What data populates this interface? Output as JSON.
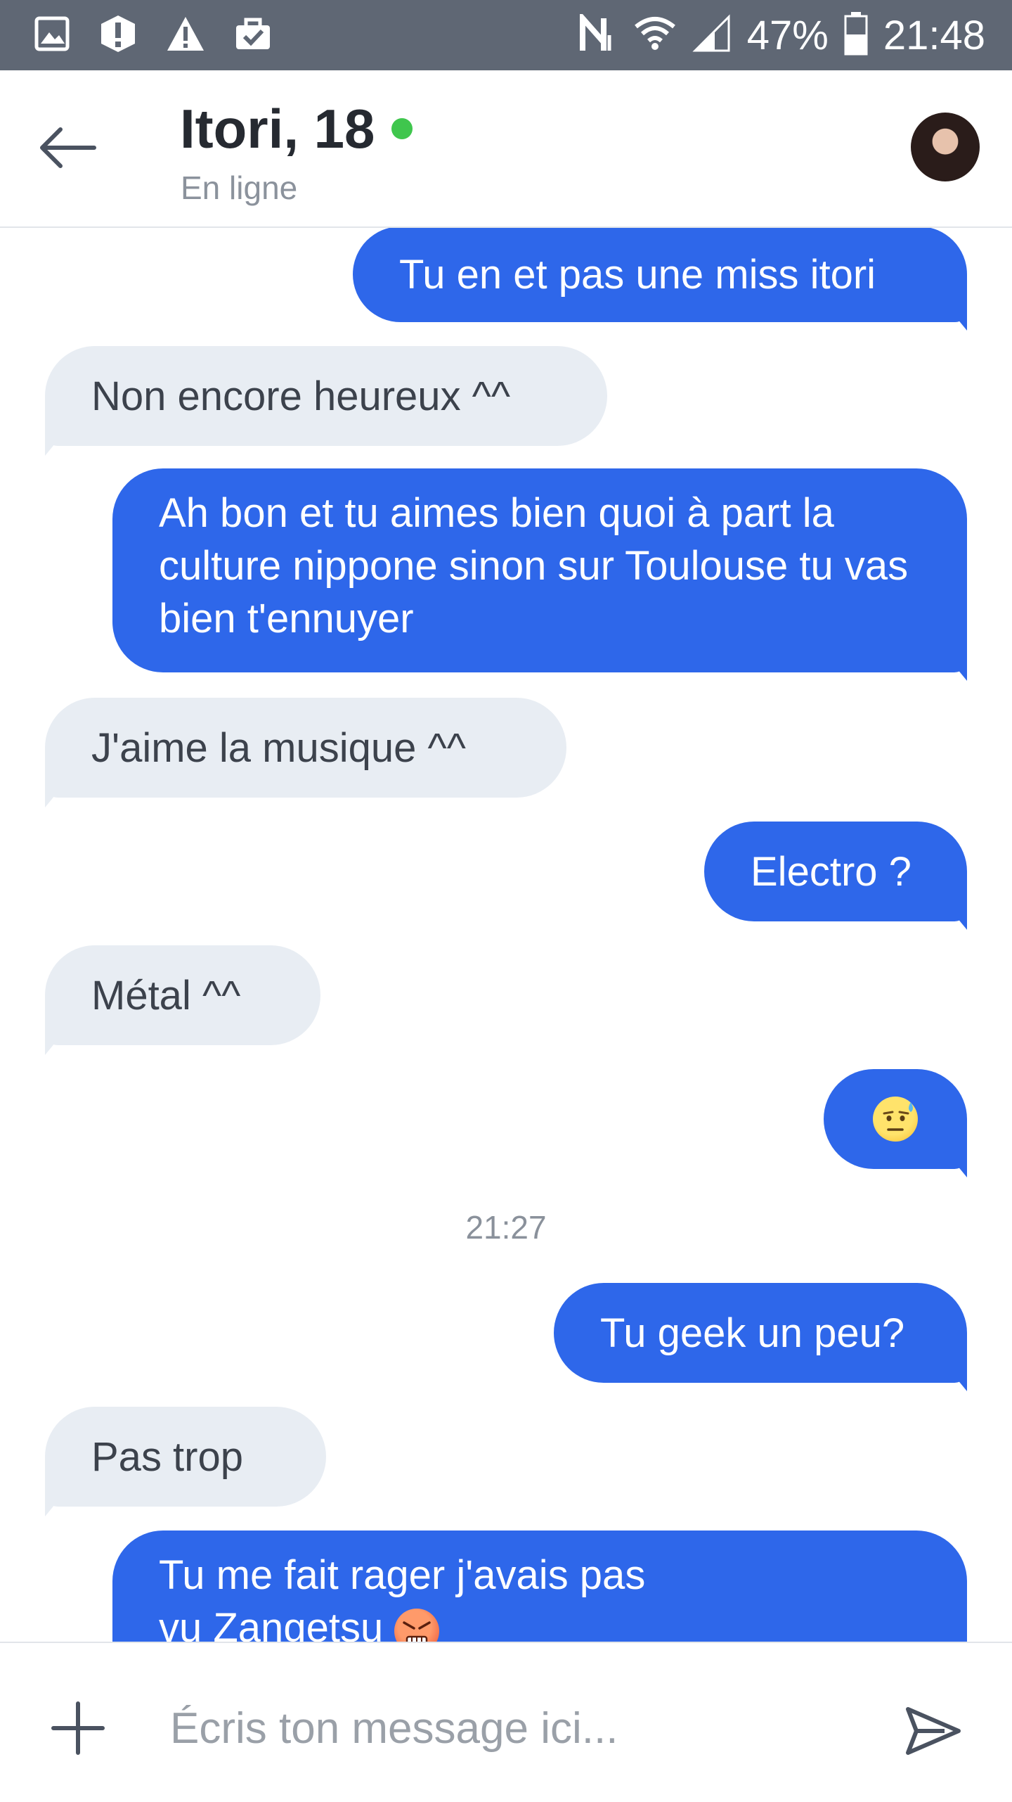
{
  "status_bar": {
    "battery_percent": "47%",
    "time": "21:48",
    "notification_icons": [
      "gallery-icon",
      "alert-circle-icon",
      "warning-icon",
      "clipboard-check-icon"
    ],
    "system_icons": [
      "nfc-icon",
      "wifi-icon",
      "cell-signal-icon",
      "battery-icon"
    ]
  },
  "header": {
    "name": "Itori, 18",
    "status": "En ligne",
    "online_color": "#3fc64d"
  },
  "messages": [
    {
      "dir": "out",
      "text": "Tu en et pas une miss itori"
    },
    {
      "dir": "in",
      "text": "Non encore heureux ^^"
    },
    {
      "dir": "out",
      "text": "Ah bon et tu aimes bien quoi à part la culture nippone sinon sur Toulouse tu vas bien t'ennuyer"
    },
    {
      "dir": "in",
      "text": "J'aime la musique ^^"
    },
    {
      "dir": "out",
      "text": "Electro ?"
    },
    {
      "dir": "in",
      "text": "Métal ^^"
    },
    {
      "dir": "out",
      "emoji": "face-with-sweat-emoji"
    },
    {
      "dir": "out",
      "text": "Tu geek un peu?"
    },
    {
      "dir": "in",
      "text": "Pas trop"
    },
    {
      "dir": "out",
      "text": "Tu me fait rager j'avais pas vu Zangetsu",
      "emoji": "angry-face-emoji"
    }
  ],
  "timestamp": "21:27",
  "input": {
    "placeholder": "Écris ton message ici..."
  },
  "colors": {
    "outgoing_bubble": "#2e67ea",
    "incoming_bubble": "#e8edf3",
    "status_bar": "#5f6774"
  }
}
